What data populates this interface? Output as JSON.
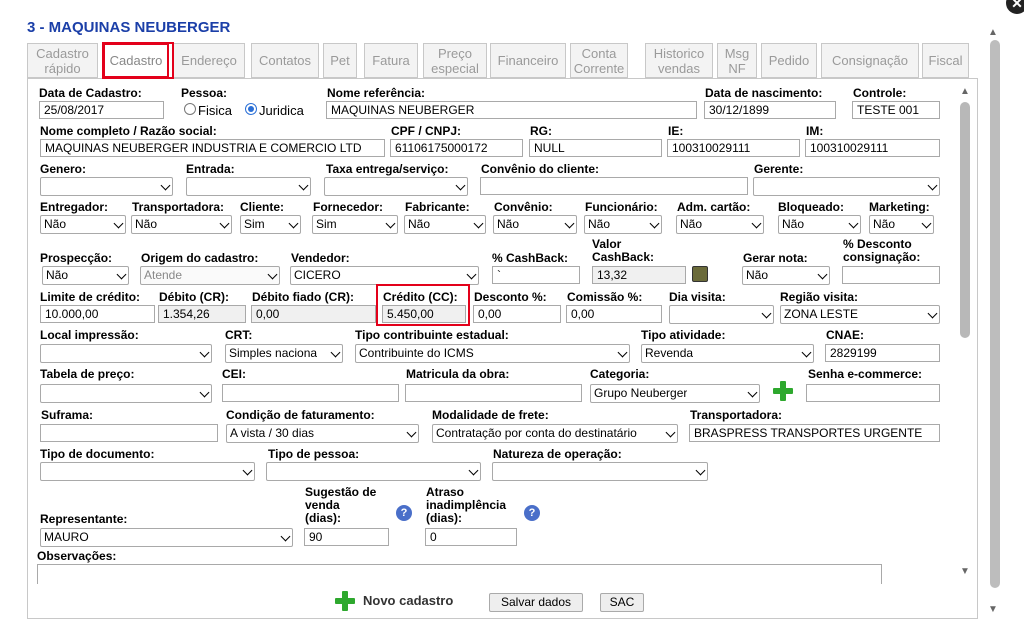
{
  "title": "3 - MAQUINAS NEUBERGER",
  "tabs": [
    {
      "label": "Cadastro\nrápido"
    },
    {
      "label": "Cadastro"
    },
    {
      "label": "Endereço"
    },
    {
      "label": "Contatos"
    },
    {
      "label": "Pet"
    },
    {
      "label": "Fatura"
    },
    {
      "label": "Preço\nespecial"
    },
    {
      "label": "Financeiro"
    },
    {
      "label": "Conta\nCorrente"
    },
    {
      "label": "Historico\nvendas"
    },
    {
      "label": "Msg\nNF"
    },
    {
      "label": "Pedido"
    },
    {
      "label": "Consignação"
    },
    {
      "label": "Fiscal"
    }
  ],
  "active_tab": "Cadastro",
  "highlight_color": "#e3001a",
  "title_color": "#1b3fa8",
  "form": {
    "data_cadastro": {
      "label": "Data de Cadastro:",
      "value": "25/08/2017"
    },
    "pessoa": {
      "label": "Pessoa:",
      "options": [
        "Fisica",
        "Juridica"
      ],
      "selected": "Juridica"
    },
    "nome_referencia": {
      "label": "Nome referência:",
      "value": "MAQUINAS NEUBERGER"
    },
    "data_nascimento": {
      "label": "Data de nascimento:",
      "value": "30/12/1899"
    },
    "controle": {
      "label": "Controle:",
      "value": "TESTE 001"
    },
    "nome_completo": {
      "label": "Nome completo / Razão social:",
      "value": "MAQUINAS NEUBERGER INDUSTRIA E COMERCIO LTD"
    },
    "cpf_cnpj": {
      "label": "CPF / CNPJ:",
      "value": "61106175000172"
    },
    "rg": {
      "label": "RG:",
      "value": "NULL"
    },
    "ie": {
      "label": "IE:",
      "value": "100310029111"
    },
    "im": {
      "label": "IM:",
      "value": "100310029111"
    },
    "genero": {
      "label": "Genero:",
      "value": ""
    },
    "entrada": {
      "label": "Entrada:",
      "value": ""
    },
    "taxa_entrega": {
      "label": "Taxa entrega/serviço:",
      "value": ""
    },
    "convenio_cliente": {
      "label": "Convênio do cliente:",
      "value": ""
    },
    "gerente": {
      "label": "Gerente:",
      "value": ""
    },
    "entregador": {
      "label": "Entregador:",
      "value": "Não"
    },
    "transportadora": {
      "label": "Transportadora:",
      "value": "Não"
    },
    "cliente": {
      "label": "Cliente:",
      "value": "Sim"
    },
    "fornecedor": {
      "label": "Fornecedor:",
      "value": "Sim"
    },
    "fabricante": {
      "label": "Fabricante:",
      "value": "Não"
    },
    "convenio": {
      "label": "Convênio:",
      "value": "Não"
    },
    "funcionario": {
      "label": "Funcionário:",
      "value": "Não"
    },
    "adm_cartao": {
      "label": "Adm. cartão:",
      "value": "Não"
    },
    "bloqueado": {
      "label": "Bloqueado:",
      "value": "Não"
    },
    "marketing": {
      "label": "Marketing:",
      "value": "Não"
    },
    "prospeccao": {
      "label": "Prospecção:",
      "value": "Não"
    },
    "origem_cadastro": {
      "label": "Origem do cadastro:",
      "value": "Atende"
    },
    "vendedor": {
      "label": "Vendedor:",
      "value": "CICERO"
    },
    "cashback_pct": {
      "label": "% CashBack:",
      "value": "`"
    },
    "valor_cashback": {
      "label": "Valor\nCashBack:",
      "value": "13,32"
    },
    "gerar_nota": {
      "label": "Gerar nota:",
      "value": "Não"
    },
    "desconto_consignacao": {
      "label": "% Desconto\nconsignação:",
      "value": ""
    },
    "limite_credito": {
      "label": "Limite de crédito:",
      "value": "10.000,00"
    },
    "debito_cr": {
      "label": "Débito (CR):",
      "value": "1.354,26"
    },
    "debito_fiado": {
      "label": "Débito fiado (CR):",
      "value": "0,00"
    },
    "credito_cc": {
      "label": "Crédito (CC):",
      "value": "5.450,00"
    },
    "desconto_pct": {
      "label": "Desconto %:",
      "value": "0,00"
    },
    "comissao_pct": {
      "label": "Comissão %:",
      "value": "0,00"
    },
    "dia_visita": {
      "label": "Dia visita:",
      "value": ""
    },
    "regiao_visita": {
      "label": "Região visita:",
      "value": "ZONA LESTE"
    },
    "local_impressao": {
      "label": "Local impressão:",
      "value": ""
    },
    "crt": {
      "label": "CRT:",
      "value": "Simples naciona"
    },
    "tipo_contribuinte": {
      "label": "Tipo contribuinte estadual:",
      "value": "Contribuinte do ICMS"
    },
    "tipo_atividade": {
      "label": "Tipo atividade:",
      "value": "Revenda"
    },
    "cnae": {
      "label": "CNAE:",
      "value": "2829199"
    },
    "tabela_preco": {
      "label": "Tabela de preço:",
      "value": ""
    },
    "cei": {
      "label": "CEI:",
      "value": ""
    },
    "matricula_obra": {
      "label": "Matricula da obra:",
      "value": ""
    },
    "categoria": {
      "label": "Categoria:",
      "value": "Grupo Neuberger"
    },
    "senha_ecommerce": {
      "label": "Senha e-commerce:",
      "value": ""
    },
    "suframa": {
      "label": "Suframa:",
      "value": ""
    },
    "condicao_faturamento": {
      "label": "Condição de faturamento:",
      "value": "A vista / 30 dias"
    },
    "modalidade_frete": {
      "label": "Modalidade de frete:",
      "value": "Contratação por conta do destinatário"
    },
    "transportadora_nome": {
      "label": "Transportadora:",
      "value": "BRASPRESS TRANSPORTES URGENTE"
    },
    "tipo_documento": {
      "label": "Tipo de documento:",
      "value": ""
    },
    "tipo_pessoa": {
      "label": "Tipo de pessoa:",
      "value": ""
    },
    "natureza_operacao": {
      "label": "Natureza de operação:",
      "value": ""
    },
    "representante": {
      "label": "Representante:",
      "value": "MAURO"
    },
    "sugestao_venda": {
      "label": "Sugestão de\nvenda\n(dias):",
      "value": "90"
    },
    "atraso_inadimplencia": {
      "label": "Atraso\ninadimplência\n(dias):",
      "value": "0"
    },
    "observacoes": {
      "label": "Observações:",
      "value": ""
    }
  },
  "buttons": {
    "novo": "Novo cadastro",
    "salvar": "Salvar dados",
    "sac": "SAC"
  },
  "icons": {
    "help": "?",
    "close": "✕"
  }
}
